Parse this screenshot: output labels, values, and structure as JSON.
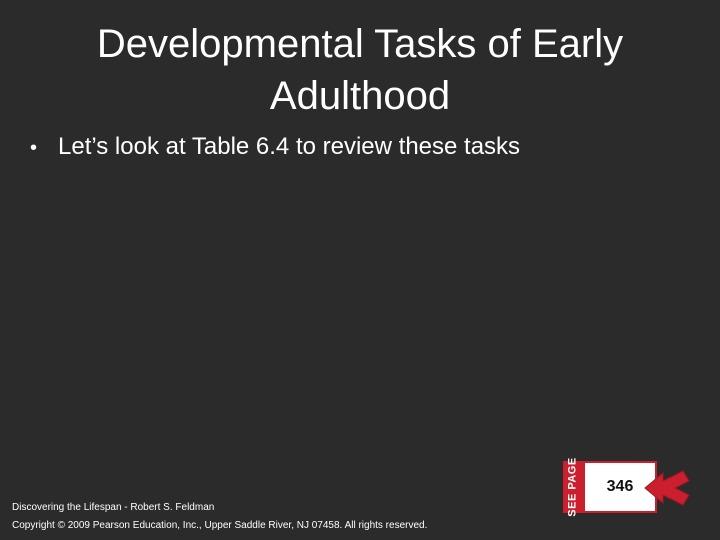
{
  "slide": {
    "title": "Developmental Tasks of Early Adulthood",
    "bullets": [
      "Let’s look at Table 6.4 to review these tasks"
    ],
    "footer_source": "Discovering the Lifespan - Robert S. Feldman",
    "footer_copyright": "Copyright © 2009 Pearson Education, Inc., Upper Saddle River, NJ 07458. All rights reserved.",
    "see_page": {
      "label": "SEE PAGE",
      "number": "346"
    }
  },
  "colors": {
    "background": "#2b2b2b",
    "text": "#ffffff",
    "accent_red": "#cc1f2e"
  },
  "icons": {
    "see_page_arrow": "arrow-pointer-icon"
  }
}
